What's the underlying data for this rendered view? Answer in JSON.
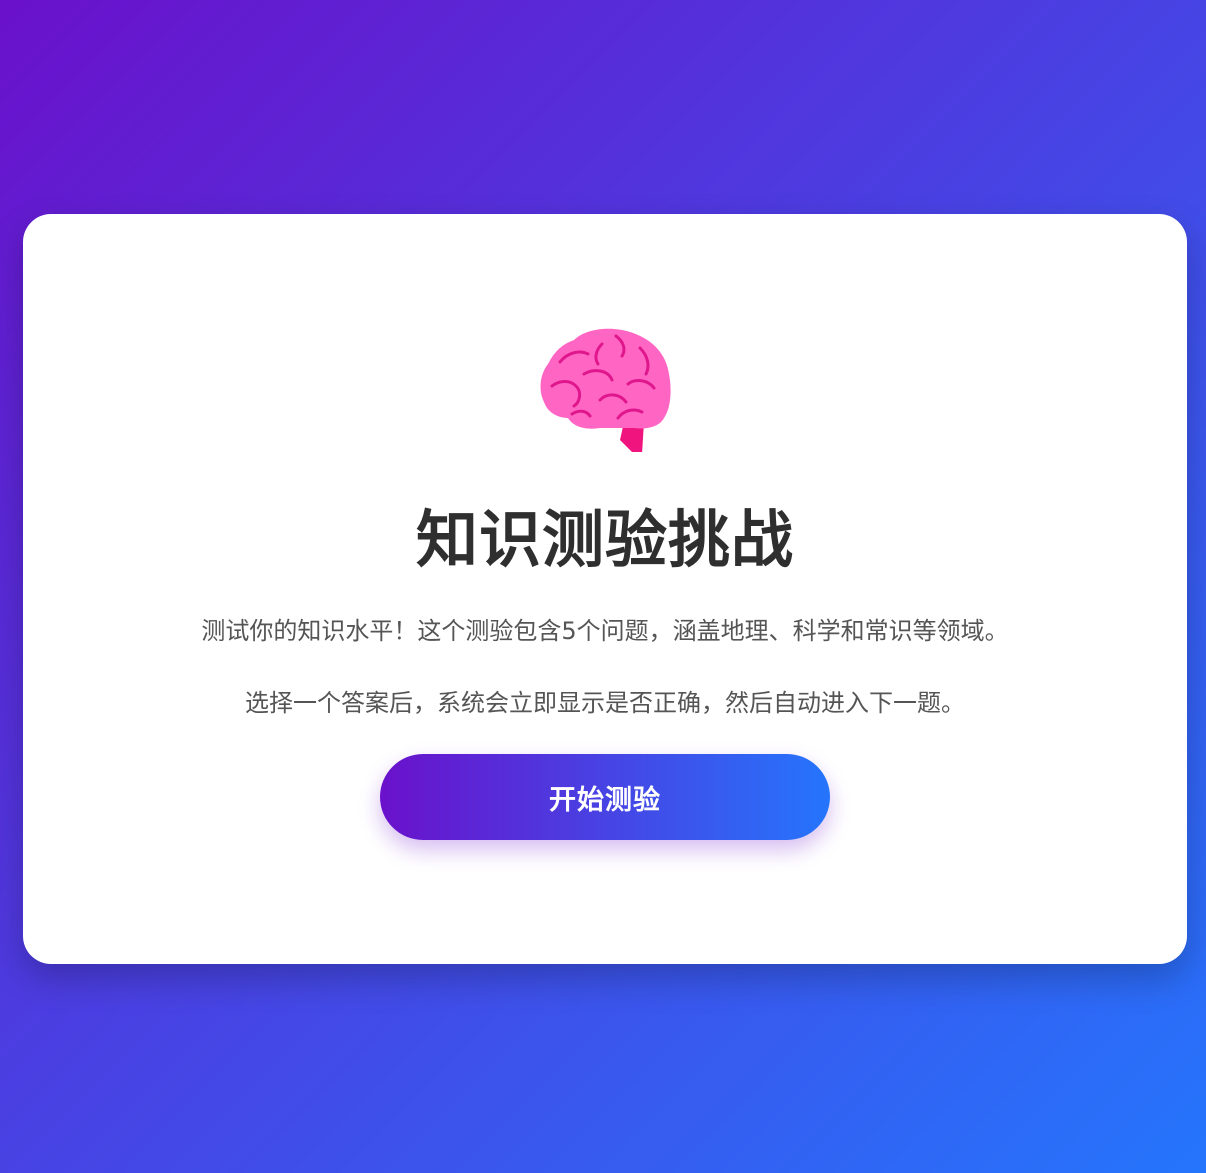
{
  "quiz": {
    "icon": "brain-icon",
    "title": "知识测验挑战",
    "description_line1": "测试你的知识水平！这个测验包含5个问题，涵盖地理、科学和常识等领域。",
    "description_line2": "选择一个答案后，系统会立即显示是否正确，然后自动进入下一题。",
    "start_button_label": "开始测验"
  },
  "colors": {
    "gradient_start": "#6a11cb",
    "gradient_end": "#2575fc",
    "brain_fill": "#ff6ec7",
    "brain_detail": "#e0178c",
    "title_color": "#2f2f2f",
    "text_color": "#555555"
  }
}
